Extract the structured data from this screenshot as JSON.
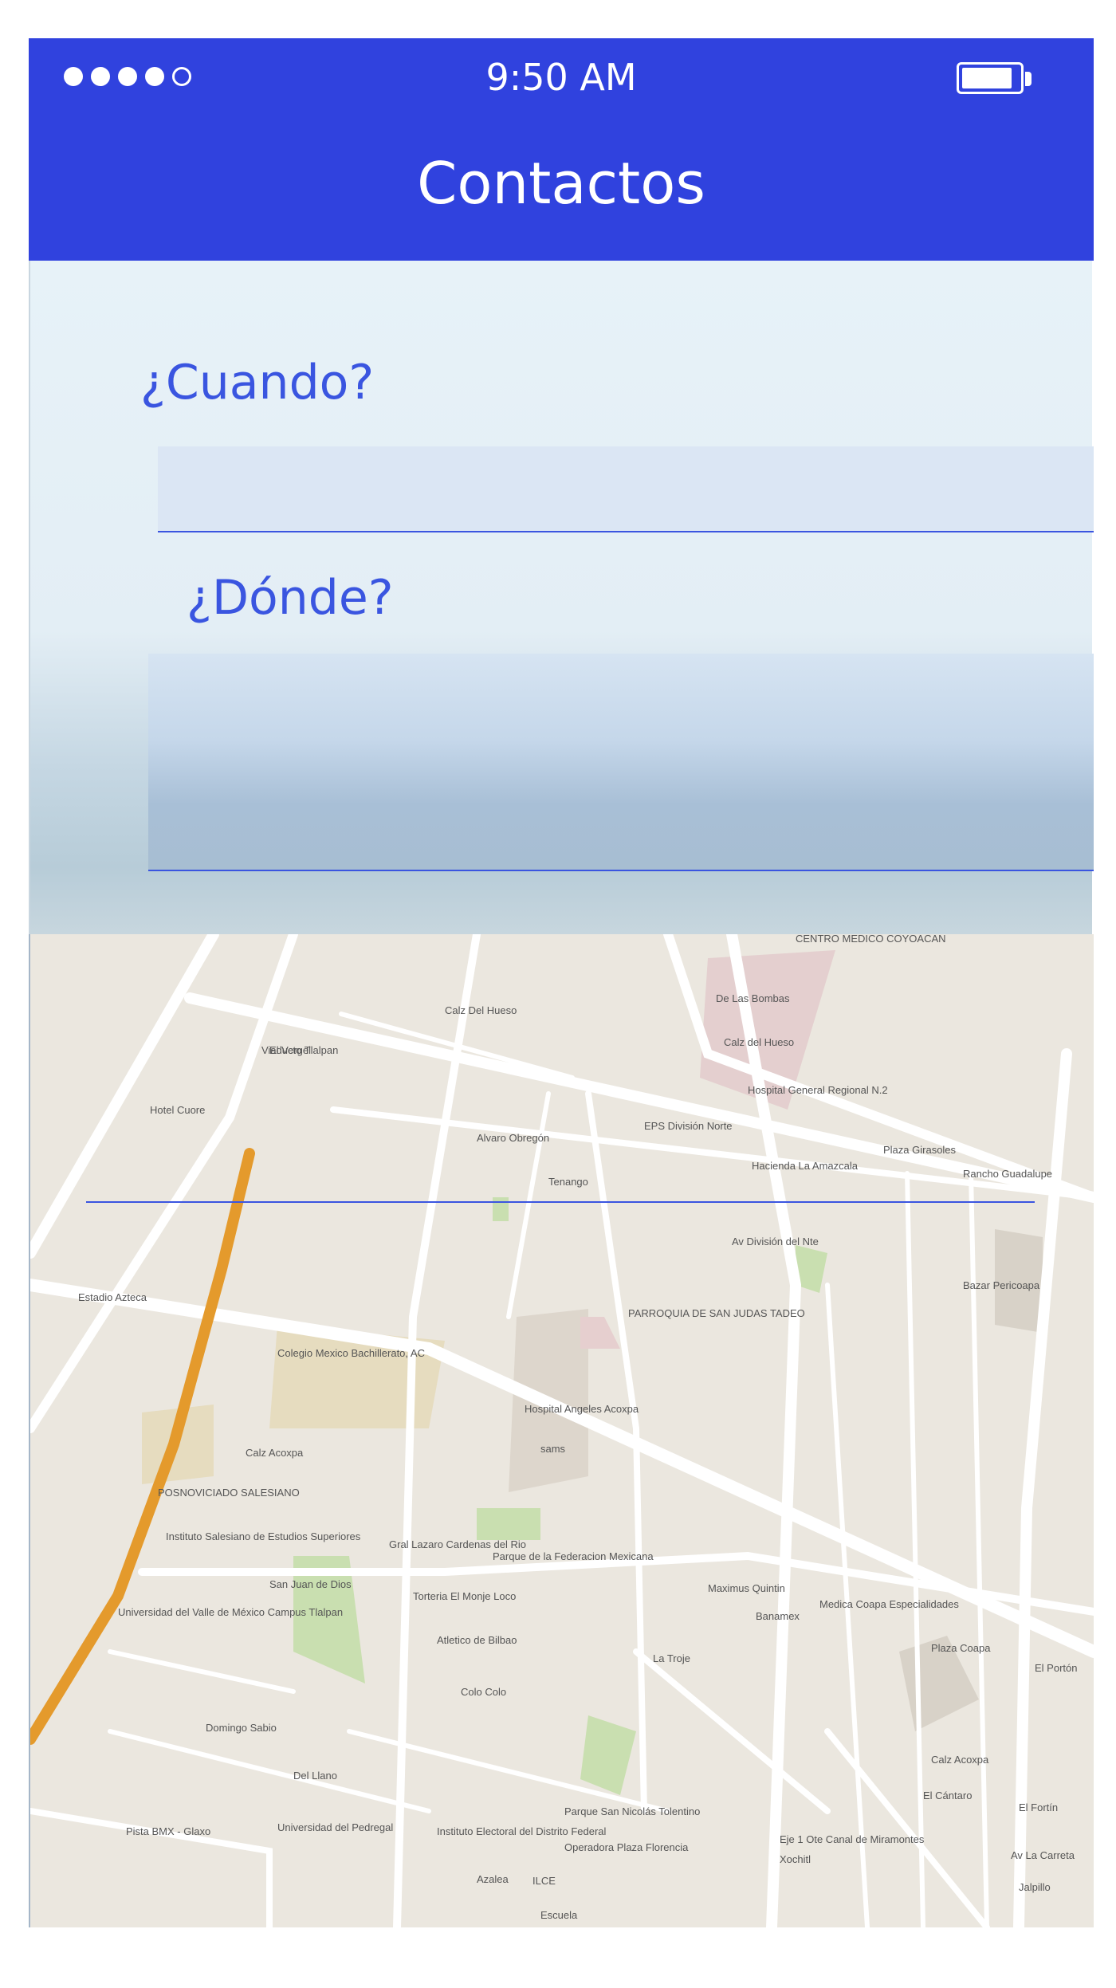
{
  "status_bar": {
    "signal_bars": 5,
    "signal_filled": 4,
    "time": "9:50 AM",
    "battery_icon": "battery-icon"
  },
  "header": {
    "title": "Contactos"
  },
  "form": {
    "when_label": "¿Cuando?",
    "when_value": "",
    "where_label": "¿Dónde?",
    "where_value": ""
  },
  "map": {
    "labels": [
      "CENTRO MEDICO COYOACAN",
      "De Las Bombas",
      "Calz Del Hueso",
      "Calz del Hueso",
      "Hospital General Regional N.2",
      "El Vergel",
      "Hotel Cuore",
      "Viaducto Tlalpan",
      "Alvaro Obregón",
      "EPS División Norte",
      "Hacienda La Amazcala",
      "Plaza Girasoles",
      "Rancho Guadalupe",
      "Tenango",
      "Av División del Nte",
      "Estadio Azteca",
      "PARROQUIA DE SAN JUDAS TADEO",
      "Bazar Pericoapa",
      "Colegio Mexico Bachillerato, AC",
      "Hospital Angeles Acoxpa",
      "sams",
      "Calz Acoxpa",
      "POSNOVICIADO SALESIANO",
      "Instituto Salesiano de Estudios Superiores",
      "Gral Lazaro Cardenas del Rio",
      "Parque de la Federacion Mexicana",
      "San Juan de Dios",
      "Maximus Quintin",
      "Universidad del Valle de México Campus Tlalpan",
      "Torteria El Monje Loco",
      "Banamex",
      "Medica Coapa Especialidades",
      "Plaza Coapa",
      "El Portón",
      "Atletico de Bilbao",
      "Colo Colo",
      "Domingo Sabio",
      "Del Llano",
      "Universidad del Pedregal",
      "Instituto Electoral del Distrito Federal",
      "Parque San Nicolás Tolentino",
      "Operadora Plaza Florencia",
      "Pista BMX - Glaxo",
      "Azalea",
      "ILCE",
      "Escuela",
      "Calz Acoxpa",
      "El Cántaro",
      "Av La Carreta",
      "Eje 1 Ote Canal de Miramontes",
      "Xochitl",
      "Jalpillo",
      "El Fortín",
      "La Troje"
    ]
  }
}
